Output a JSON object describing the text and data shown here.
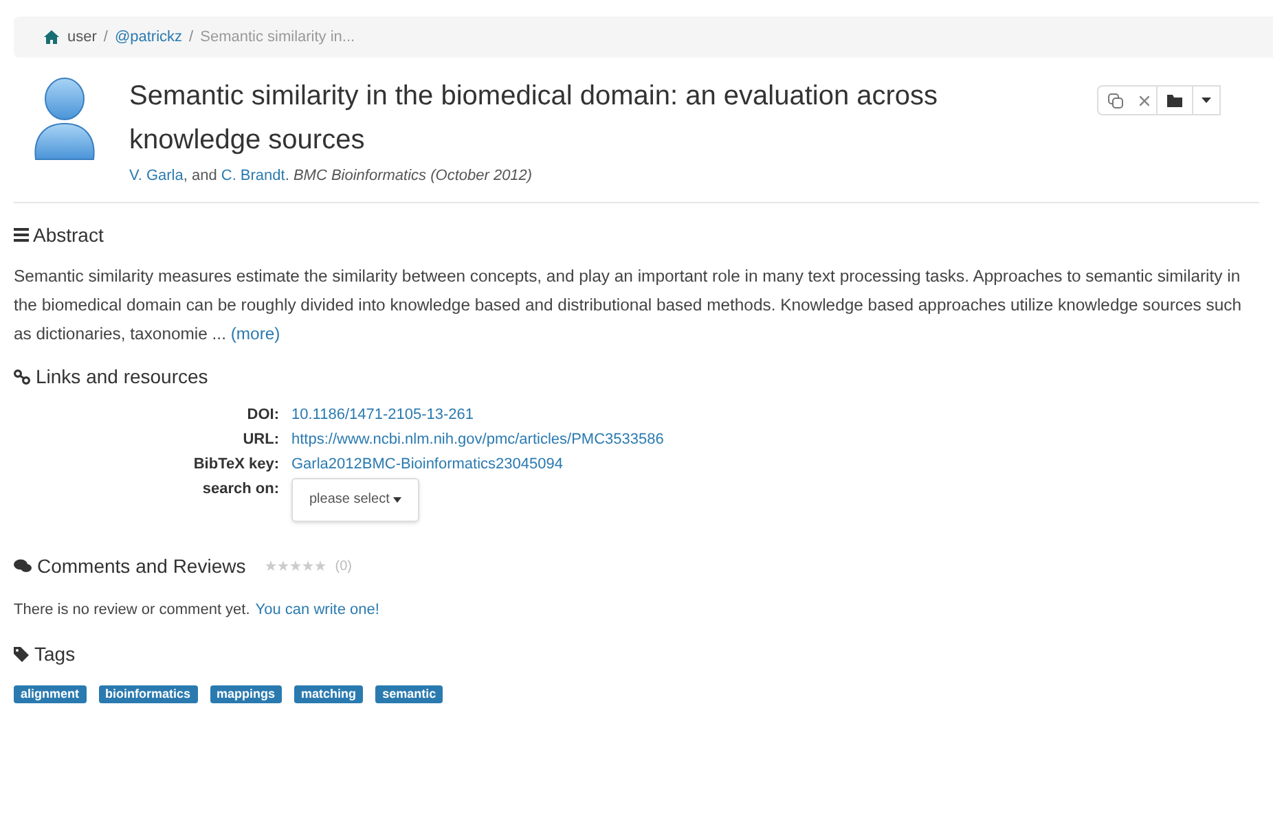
{
  "breadcrumb_separator": "/",
  "breadcrumb": [
    {
      "label": "user",
      "kind": "text"
    },
    {
      "label": "@patrickz",
      "kind": "link"
    },
    {
      "label": "Semantic similarity in...",
      "kind": "current"
    }
  ],
  "post": {
    "title": "Semantic similarity in the biomedical domain: an evaluation across knowledge sources",
    "authors": [
      "V. Garla",
      "C. Brandt"
    ],
    "conjunction": ", and",
    "authors_end": ".",
    "journal": "BMC Bioinformatics",
    "date": "(October 2012)"
  },
  "abstract": {
    "heading": "Abstract",
    "text": "Semantic similarity measures estimate the similarity between concepts, and play an important role in many text processing tasks. Approaches to semantic similarity in the biomedical domain can be roughly divided into knowledge based and distributional based methods. Knowledge based approaches utilize knowledge sources such as dictionaries, taxonomie ...",
    "more": "(more)"
  },
  "links": {
    "heading": "Links and resources",
    "rows": [
      {
        "label": "DOI:",
        "value": "10.1186/1471-2105-13-261",
        "kind": "link"
      },
      {
        "label": "URL:",
        "value": "https://www.ncbi.nlm.nih.gov/pmc/articles/PMC3533586",
        "kind": "link"
      },
      {
        "label": "BibTeX key:",
        "value": "Garla2012BMC-Bioinformatics23045094",
        "kind": "link"
      },
      {
        "label": "search on:",
        "value": "please select",
        "kind": "dropdown"
      }
    ]
  },
  "comments": {
    "heading": "Comments and Reviews",
    "stars": 0,
    "count": "(0)",
    "text": "There is no review or comment yet.",
    "link": "You can write one!"
  },
  "tags": {
    "heading": "Tags",
    "items": [
      "alignment",
      "bioinformatics",
      "mappings",
      "matching",
      "semantic"
    ]
  }
}
